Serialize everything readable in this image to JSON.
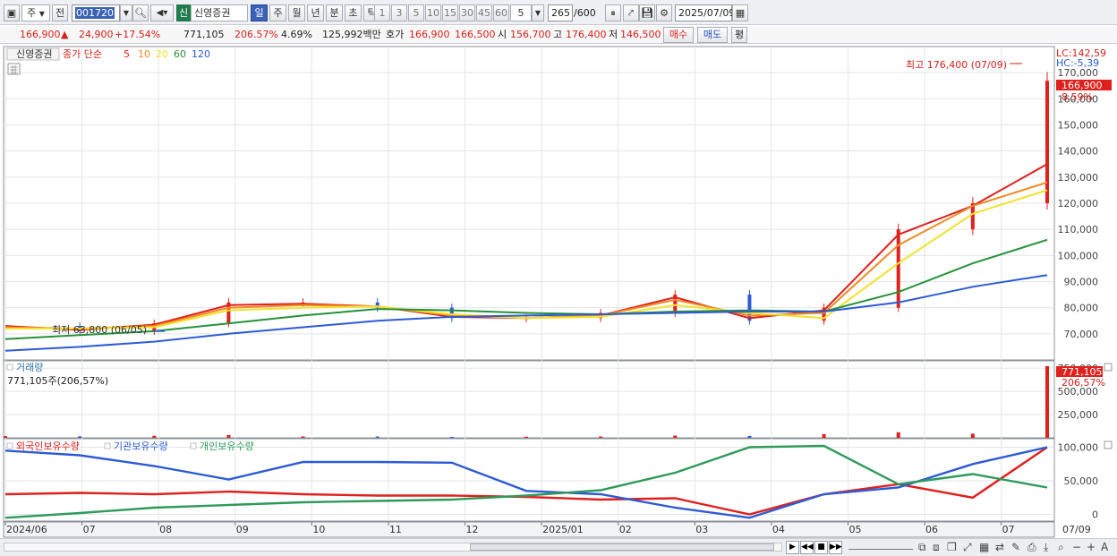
{
  "toolbar": {
    "period_type": "주",
    "prev_label": "전",
    "code_value": "001720",
    "stock_badge": "신",
    "stock_name": "신영증권",
    "period_buttons": [
      "일",
      "주",
      "월",
      "년",
      "분",
      "초",
      "틱"
    ],
    "interval_buttons": [
      "1",
      "3",
      "5",
      "10",
      "15",
      "30",
      "45",
      "60"
    ],
    "interval_value": "5",
    "count_value": "265",
    "count_max": "/600",
    "date_value": "2025/07/09"
  },
  "quote": {
    "price": "166,900",
    "change_arrow": "▲",
    "change": "24,900",
    "change_pct": "+17.54%",
    "volume": "771,105",
    "volume_ratio": "206.57%",
    "turnover": "4.69%",
    "trade_amount": "125,992백만",
    "ask_label": "호가",
    "ask": "166,900",
    "bid": "166,500",
    "open_label": "시",
    "open": "156,700",
    "high_label": "고",
    "high": "176,400",
    "low_label": "저",
    "low": "146,500",
    "buy_label": "매수",
    "sell_label": "매도",
    "eval_label": "평"
  },
  "price_pane": {
    "legend_stock": "신영증권",
    "legend_ma_title": "종가 단순",
    "ma_periods": [
      "5",
      "10",
      "20",
      "60",
      "120"
    ],
    "ma_colors": [
      "#e0201c",
      "#f08a24",
      "#f2e22a",
      "#27913a",
      "#2d5bd6"
    ],
    "lc_label": "LC:142,59",
    "hc_label": "HC:-5,39",
    "price_tag": "166,900",
    "price_tag_pct": "8.59%",
    "high_annotation": "최고 176,400 (07/09)",
    "low_annotation": "최저 63,800 (06/05)"
  },
  "volume_pane": {
    "title": "거래량",
    "value_label": "771,105주(206,57%)",
    "tag_value": "771,105",
    "tag_pct": "206,57%"
  },
  "holding_pane": {
    "legend": [
      "외국인보유수량",
      "기관보유수량",
      "개인보유수량"
    ],
    "colors": [
      "#e0201c",
      "#2d5bd6",
      "#2e9a5a"
    ]
  },
  "x_axis": {
    "labels": [
      "2024/06",
      "07",
      "08",
      "09",
      "10",
      "11",
      "12",
      "2025/01",
      "02",
      "03",
      "04",
      "05",
      "06",
      "07",
      "07/09"
    ]
  },
  "chart_data": {
    "type": "line",
    "title": "신영증권",
    "price_axis": {
      "ylim": [
        60000,
        180000
      ],
      "ticks": [
        "70,000",
        "80,000",
        "90,000",
        "100,000",
        "110,000",
        "120,000",
        "130,000",
        "140,000",
        "150,000",
        "160,000",
        "170,000"
      ]
    },
    "volume_axis": {
      "ylim": [
        0,
        800000
      ],
      "ticks": [
        "250,000",
        "500,000",
        "750,000"
      ]
    },
    "holding_axis": {
      "ylim": [
        -10000,
        110000
      ],
      "ticks": [
        "0",
        "50,000",
        "100,000"
      ]
    },
    "x": [
      "2024/06",
      "07",
      "08",
      "09",
      "10",
      "11",
      "12",
      "2025/01",
      "02",
      "03",
      "04",
      "05",
      "06",
      "07"
    ],
    "series": [
      {
        "name": "종가",
        "values": [
          73000,
          71000,
          74000,
          82000,
          82000,
          80000,
          76000,
          76000,
          78000,
          85000,
          75000,
          80000,
          110000,
          120000,
          166900
        ]
      },
      {
        "name": "5",
        "values": [
          73000,
          71500,
          73500,
          81000,
          81500,
          80500,
          76500,
          76000,
          77000,
          84000,
          76000,
          79000,
          108000,
          119000,
          135000
        ]
      },
      {
        "name": "10",
        "values": [
          72500,
          72000,
          73000,
          80000,
          81000,
          80500,
          77000,
          76000,
          77000,
          83000,
          77000,
          78000,
          104000,
          119000,
          128000
        ]
      },
      {
        "name": "20",
        "values": [
          72000,
          72000,
          72500,
          79000,
          80000,
          80500,
          77500,
          76000,
          76500,
          81000,
          78000,
          76000,
          97000,
          116000,
          125000
        ]
      },
      {
        "name": "60",
        "values": [
          68000,
          69500,
          71000,
          74000,
          77000,
          79500,
          79000,
          78000,
          77500,
          78500,
          79000,
          78500,
          86000,
          97000,
          106000
        ]
      },
      {
        "name": "120",
        "values": [
          63500,
          65000,
          67000,
          70000,
          72500,
          75000,
          76500,
          77000,
          77500,
          78000,
          78500,
          78500,
          82000,
          88000,
          92500
        ]
      },
      {
        "name": "외국인보유수량",
        "values": [
          30000,
          32000,
          30000,
          34000,
          30000,
          28000,
          28000,
          26000,
          22000,
          24000,
          0,
          30000,
          45000,
          25000,
          100000
        ]
      },
      {
        "name": "기관보유수량",
        "values": [
          95000,
          88000,
          72000,
          52000,
          78000,
          78000,
          77000,
          35000,
          30000,
          10000,
          -5000,
          30000,
          40000,
          75000,
          100000
        ]
      },
      {
        "name": "개인보유수량",
        "values": [
          -5000,
          2000,
          10000,
          14000,
          18000,
          20000,
          22000,
          28000,
          36000,
          62000,
          100000,
          102000,
          45000,
          60000,
          40000
        ]
      }
    ],
    "volume_values": [
      18000,
      16000,
      22000,
      30000,
      15000,
      14000,
      10000,
      12000,
      14000,
      24000,
      20000,
      40000,
      60000,
      45000,
      771105
    ]
  }
}
